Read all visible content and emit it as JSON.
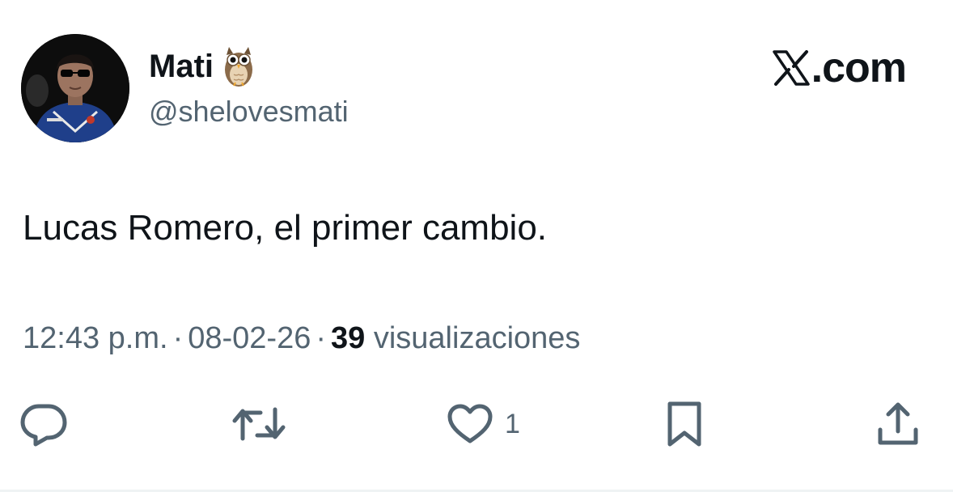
{
  "source": {
    "brand_text": ".com",
    "brand_icon": "x-logo-icon"
  },
  "author": {
    "display_name": "Mati",
    "badge_emoji": "owl-emoji",
    "username": "@shelovesmati",
    "avatar_icon": "avatar"
  },
  "tweet": {
    "text": "Lucas Romero, el primer cambio.",
    "time": "12:43 p.m.",
    "separator": "·",
    "date": "08-02-26",
    "views_count": "39",
    "views_label": "visualizaciones"
  },
  "actions": {
    "reply": {
      "icon": "reply-icon",
      "count": ""
    },
    "retweet": {
      "icon": "retweet-icon",
      "count": ""
    },
    "like": {
      "icon": "heart-icon",
      "count": "1"
    },
    "bookmark": {
      "icon": "bookmark-icon",
      "count": ""
    },
    "share": {
      "icon": "share-icon",
      "count": ""
    }
  },
  "colors": {
    "text_primary": "#0f1419",
    "text_secondary": "#536471",
    "icon": "#536471",
    "background": "#ffffff"
  }
}
